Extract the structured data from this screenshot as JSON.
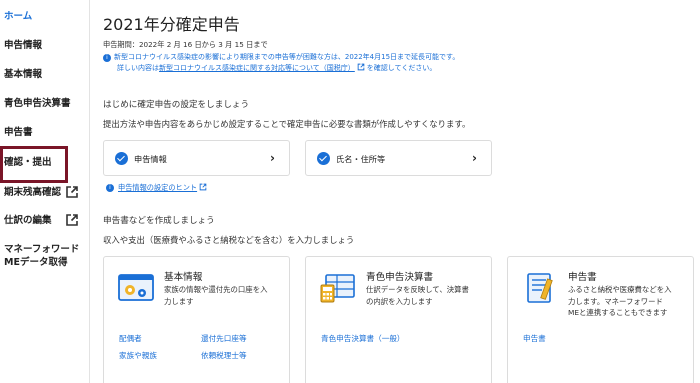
{
  "sidebar": {
    "items": [
      {
        "label": "ホーム"
      },
      {
        "label": "申告情報"
      },
      {
        "label": "基本情報"
      },
      {
        "label": "青色申告決算書"
      },
      {
        "label": "申告書"
      },
      {
        "label": "確認・提出"
      },
      {
        "label": "期末残高確認"
      },
      {
        "label": "仕訳の編集"
      },
      {
        "label": "マネーフォワード"
      },
      {
        "label": "MEデータ取得"
      }
    ]
  },
  "main": {
    "title": "2021年分確定申告",
    "period": "申告期間：2022年 2 月 16 日から 3 月 15 日まで",
    "notice_line1": "新型コロナウイルス感染症の影響により期限までの申告等が困難な方は、2022年4月15日まで延長可能です。",
    "notice_line2_pre": "詳しい内容は",
    "notice_link": "新型コロナウイルス感染症に関する対応等について（国税庁）",
    "notice_line2_post": "を確認してください。",
    "setup_heading": "はじめに確定申告の設定をしましょう",
    "setup_sub": "提出方法や申告内容をあらかじめ設定することで確定申告に必要な書類が作成しやすくなります。",
    "setup_cards": [
      {
        "label": "申告情報"
      },
      {
        "label": "氏名・住所等"
      }
    ],
    "hint_link": "申告情報の設定のヒント",
    "create_heading": "申告書などを作成しましょう",
    "create_sub": "収入や支出（医療費やふるさと納税などを含む）を入力しましょう",
    "cards": [
      {
        "title": "基本情報",
        "desc1": "家族の情報や還付先の口座を入",
        "desc2": "力します",
        "links": [
          "配偶者",
          "還付先口座等",
          "家族や親族",
          "依頼税理士等"
        ]
      },
      {
        "title": "青色申告決算書",
        "desc1": "仕訳データを反映して、決算書",
        "desc2": "の内訳を入力します",
        "links": [
          "青色申告決算書（一般）"
        ]
      },
      {
        "title": "申告書",
        "desc1": "ふるさと納税や医療費などを入",
        "desc2": "力します。マネーフォワード",
        "desc3": "MEと連携することもできます",
        "links": [
          "申告書"
        ]
      }
    ]
  },
  "colors": {
    "accent": "#1a6fd6",
    "highlight": "#7a1528"
  }
}
